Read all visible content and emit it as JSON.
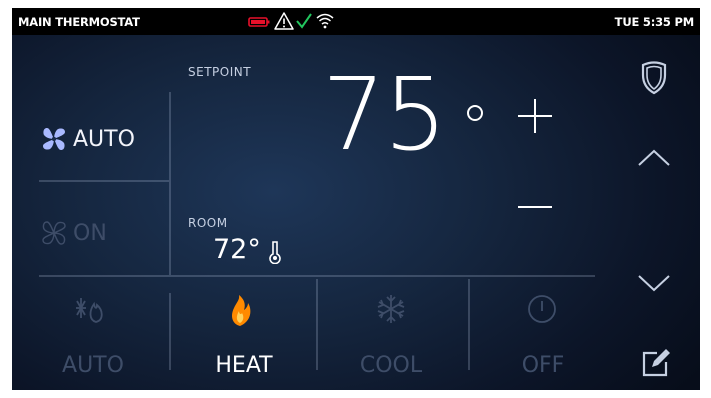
{
  "status_bar": {
    "title": "MAIN THERMOSTAT",
    "time": "TUE 5:35 PM",
    "icons": [
      "battery-low-icon",
      "warning-icon",
      "checkmark-icon",
      "wifi-icon"
    ],
    "colors": {
      "battery": "#e8102a",
      "check": "#22c55e"
    }
  },
  "fan": {
    "options": [
      {
        "label": "AUTO",
        "icon": "fan-icon",
        "state": "selected"
      },
      {
        "label": "ON",
        "icon": "fan-icon",
        "state": "unselected"
      }
    ]
  },
  "setpoint": {
    "label": "SETPOINT",
    "value": "75",
    "unit_symbol": "degree"
  },
  "room": {
    "label": "ROOM",
    "value": "72°",
    "icon": "thermometer-icon"
  },
  "controls": {
    "increase": "plus-icon",
    "decrease": "minus-icon"
  },
  "modes": [
    {
      "label": "AUTO",
      "icon": "heat-cool-auto-icon",
      "active": false
    },
    {
      "label": "HEAT",
      "icon": "flame-icon",
      "active": true
    },
    {
      "label": "COOL",
      "icon": "snowflake-icon",
      "active": false
    },
    {
      "label": "OFF",
      "icon": "power-icon",
      "active": false
    }
  ],
  "side_nav": [
    "shield-icon",
    "chevron-up-icon",
    "chevron-down-icon",
    "edit-icon"
  ],
  "theme": {
    "accent_icon": "#a9b9ff",
    "inactive": "#3e4d68",
    "flame": "#ff8a00"
  }
}
